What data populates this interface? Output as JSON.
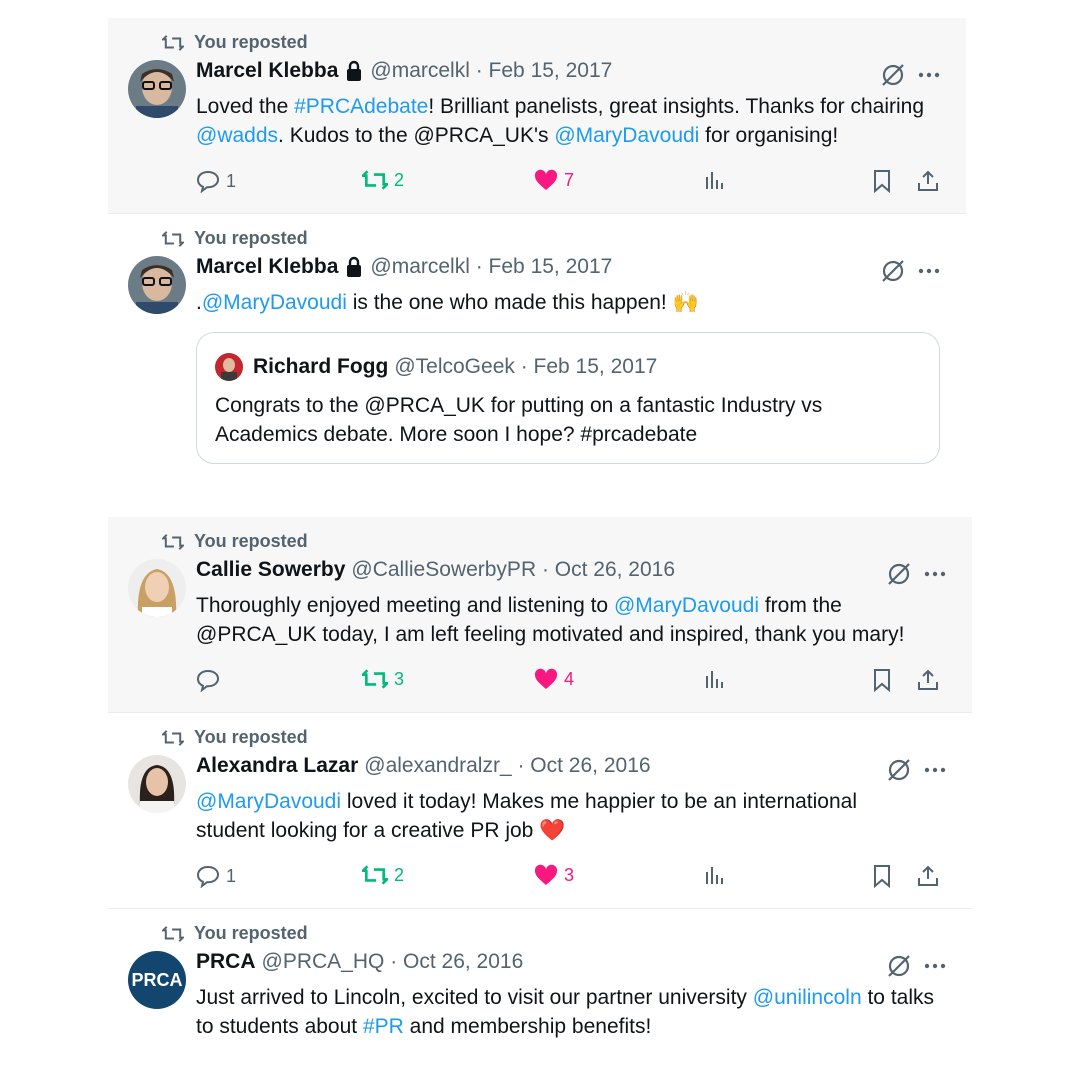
{
  "repost_label": "You reposted",
  "colors": {
    "link": "#1d9bf0",
    "retweet": "#00ba7c",
    "like": "#f91880",
    "muted": "#536471"
  },
  "panel1": {
    "tweets": [
      {
        "name": "Marcel Klebba",
        "meta": "@marcelkl · Feb 15, 2017",
        "text": [
          "Loved the ",
          "#PRCAdebate",
          "! Brilliant panelists, great insights. Thanks for chairing ",
          "@wadds",
          ". Kudos to the @PRCA_UK's ",
          "@MaryDavoudi",
          " for organising!"
        ],
        "replies": "1",
        "reposts": "2",
        "likes": "7"
      },
      {
        "name": "Marcel Klebba",
        "meta": "@marcelkl · Feb 15, 2017",
        "text": [
          ".",
          "@MaryDavoudi",
          " is the one who made this happen! 🙌"
        ],
        "quote": {
          "name": "Richard Fogg",
          "meta": "@TelcoGeek · Feb 15, 2017",
          "text": "Congrats to the @PRCA_UK for putting on a fantastic Industry vs Academics debate. More soon I hope? #prcadebate"
        }
      }
    ]
  },
  "panel2": {
    "tweets": [
      {
        "name": "Callie Sowerby",
        "meta": "@CallieSowerbyPR · Oct 26, 2016",
        "text": [
          "Thoroughly enjoyed meeting and listening to ",
          "@MaryDavoudi",
          " from the @PRCA_UK today, I am left feeling motivated and inspired, thank you mary!"
        ],
        "replies": "",
        "reposts": "3",
        "likes": "4"
      },
      {
        "name": "Alexandra Lazar",
        "meta": "@alexandralzr_ · Oct 26, 2016",
        "text": [
          "",
          "@MaryDavoudi",
          " loved it today! Makes me happier to be an international student looking for a creative PR job ❤️"
        ],
        "replies": "1",
        "reposts": "2",
        "likes": "3"
      },
      {
        "name": "PRCA",
        "meta": "@PRCA_HQ · Oct 26, 2016",
        "avatar_text": "PRCA",
        "text": [
          "Just arrived to Lincoln, excited to visit our partner university ",
          "@unilincoln",
          " to talks to students about ",
          "#PR",
          " and membership benefits!"
        ]
      }
    ]
  }
}
